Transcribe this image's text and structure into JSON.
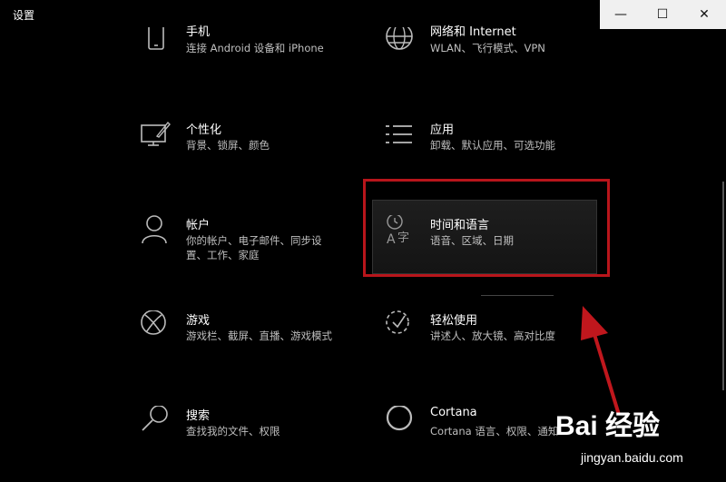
{
  "window": {
    "title": "设置",
    "minimize": "—",
    "maximize": "☐",
    "close": "✕"
  },
  "tiles": [
    {
      "label": "手机",
      "desc": "连接 Android 设备和 iPhone",
      "icon": "phone-icon"
    },
    {
      "label": "网络和 Internet",
      "desc": "WLAN、飞行模式、VPN",
      "icon": "globe-icon"
    },
    {
      "label": "个性化",
      "desc": "背景、锁屏、颜色",
      "icon": "personalization-icon"
    },
    {
      "label": "应用",
      "desc": "卸载、默认应用、可选功能",
      "icon": "apps-list-icon"
    },
    {
      "label": "帐户",
      "desc": "你的帐户、电子邮件、同步设置、工作、家庭",
      "icon": "person-icon"
    },
    {
      "label": "时间和语言",
      "desc": "语音、区域、日期",
      "icon": "time-language-icon"
    },
    {
      "label": "游戏",
      "desc": "游戏栏、截屏、直播、游戏模式",
      "icon": "xbox-icon"
    },
    {
      "label": "轻松使用",
      "desc": "讲述人、放大镜、高对比度",
      "icon": "ease-of-access-icon"
    },
    {
      "label": "搜索",
      "desc": "查找我的文件、权限",
      "icon": "search-icon"
    },
    {
      "label": "Cortana",
      "desc": "Cortana 语言、权限、通知",
      "icon": "cortana-icon"
    }
  ],
  "watermark": {
    "logo": "Bai 经验",
    "url": "jingyan.baidu.com"
  },
  "colors": {
    "background": "#000000",
    "highlight": "#b8151b",
    "arrow": "#c0171d"
  }
}
